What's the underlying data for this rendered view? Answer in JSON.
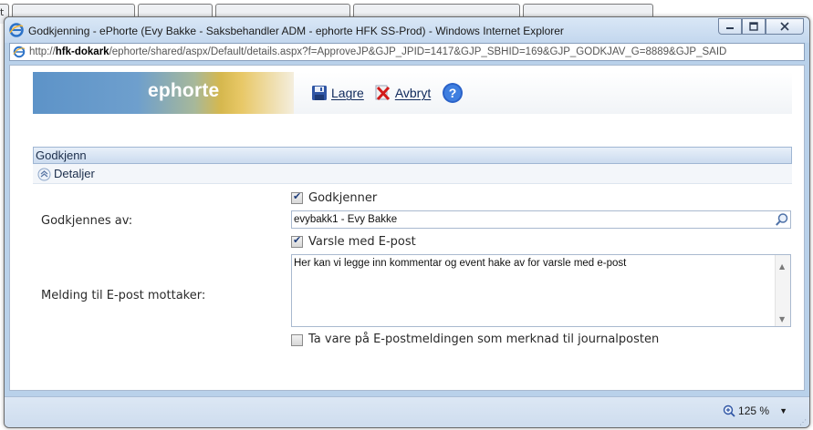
{
  "background": {
    "tab_letter": "t"
  },
  "window": {
    "title": "Godkjenning - ePhorte (Evy Bakke - Saksbehandler ADM - ephorte HFK SS-Prod) - Windows Internet Explorer",
    "address_prefix": "http://",
    "address_host": "hfk-dokark",
    "address_rest": "/ephorte/shared/aspx/Default/details.aspx?f=ApproveJP&GJP_JPID=1417&GJP_SBHID=169&GJP_GODKJAV_G=8889&GJP_SAID"
  },
  "app": {
    "logo_text": "ephorte",
    "toolbar": {
      "save_label": "Lagre",
      "cancel_label": "Avbryt"
    }
  },
  "section": {
    "title": "Godkjenn",
    "subsection_title": "Detaljer"
  },
  "form": {
    "approver_checkbox_label": "Godkjenner",
    "approver_checked": true,
    "approved_by_label": "Godkjennes av:",
    "approved_by_value": "evybakk1 - Evy Bakke",
    "notify_checkbox_label": "Varsle med E-post",
    "notify_checked": true,
    "message_label": "Melding til E-post mottaker:",
    "message_value": "Her kan vi legge inn kommentar og event hake av for varsle med e-post",
    "keep_checkbox_label": "Ta vare på E-postmeldingen som merknad til journalposten",
    "keep_checked": false
  },
  "statusbar": {
    "zoom": "125 %"
  },
  "colors": {
    "accent": "#102a5c",
    "section_header": "#cbdbef"
  }
}
